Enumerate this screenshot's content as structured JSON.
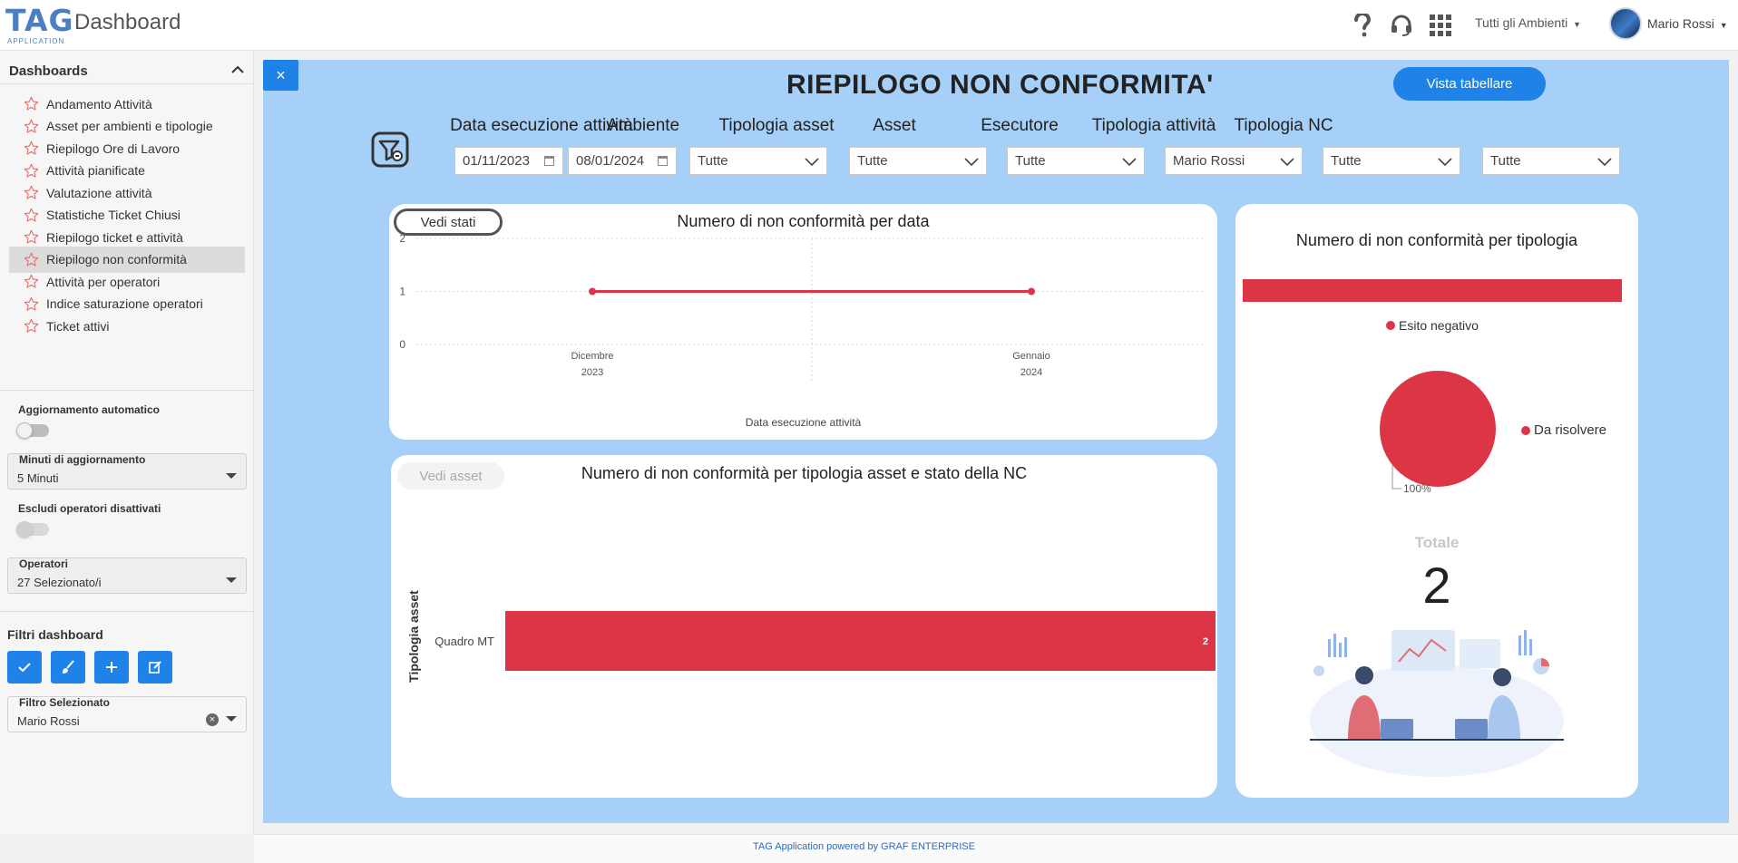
{
  "app": {
    "logo_text": "TAG",
    "logo_sub": "APPLICATION",
    "page_title": "Dashboard",
    "environment_selector": "Tutti gli Ambienti",
    "user_name": "Mario Rossi"
  },
  "sidebar": {
    "title": "Dashboards",
    "items": [
      {
        "label": "Andamento Attività"
      },
      {
        "label": "Asset per ambienti e tipologie"
      },
      {
        "label": "Riepilogo Ore di Lavoro"
      },
      {
        "label": "Attività pianificate"
      },
      {
        "label": "Valutazione attività"
      },
      {
        "label": "Statistiche Ticket Chiusi"
      },
      {
        "label": "Riepilogo ticket e attività"
      },
      {
        "label": "Riepilogo non conformità",
        "active": true
      },
      {
        "label": "Attività per operatori"
      },
      {
        "label": "Indice saturazione operatori"
      },
      {
        "label": "Ticket attivi"
      }
    ],
    "auto_update_label": "Aggiornamento automatico",
    "auto_update_on": false,
    "minutes_label": "Minuti di aggiornamento",
    "minutes_value": "5 Minuti",
    "exclude_label": "Escludi operatori disattivati",
    "exclude_on": false,
    "operators_label": "Operatori",
    "operators_value": "27 Selezionato/i",
    "filters_title": "Filtri dashboard",
    "filter_buttons": [
      "check-icon",
      "brush-icon",
      "plus-icon",
      "edit-icon"
    ],
    "selected_filter_label": "Filtro Selezionato",
    "selected_filter_value": "Mario Rossi"
  },
  "report": {
    "title": "RIEPILOGO NON CONFORMITA'",
    "table_view_button": "Vista tabellare",
    "close_label": "×",
    "filters": [
      {
        "label": "Data esecuzione attività",
        "from": "01/11/2023",
        "to": "08/01/2024"
      },
      {
        "label": "Ambiente",
        "value": "Tutte"
      },
      {
        "label": "Tipologia asset",
        "value": "Tutte"
      },
      {
        "label": "Asset",
        "value": "Tutte"
      },
      {
        "label": "Esecutore",
        "value": "Mario Rossi"
      },
      {
        "label": "Tipologia attività",
        "value": "Tutte"
      },
      {
        "label": "Tipologia NC",
        "value": "Tutte"
      }
    ],
    "accent_color": "#dc3545",
    "primary_color": "#1e82e8"
  },
  "line_card": {
    "button": "Vedi stati",
    "title": "Numero di non conformità per data"
  },
  "bar_card": {
    "button": "Vedi asset",
    "title": "Numero di non conformità per tipologia asset e stato della NC"
  },
  "pie_card": {
    "title": "Numero di non conformità per tipologia",
    "totale_label": "Totale",
    "totale_value": "2"
  },
  "chart_data": [
    {
      "type": "line",
      "title": "Numero di non conformità per data",
      "xlabel": "Data esecuzione attività",
      "ylabel": "",
      "x": [
        {
          "line1": "Dicembre",
          "line2": "2023"
        },
        {
          "line1": "Gennaio",
          "line2": "2024"
        }
      ],
      "series": [
        {
          "values": [
            1,
            1
          ]
        }
      ],
      "yticks": [
        "0",
        "1",
        "2"
      ],
      "ylim": [
        0,
        2
      ],
      "grid": true
    },
    {
      "type": "bar",
      "orientation": "horizontal",
      "title": "Numero di non conformità per tipologia asset e stato della NC",
      "ylabel": "Tipologia asset",
      "categories": [
        "Quadro MT"
      ],
      "values": [
        2
      ],
      "data_labels": [
        "2"
      ]
    },
    {
      "type": "pie",
      "title": "Numero di non conformità per tipologia",
      "legend_top": [
        "Esito negativo"
      ],
      "slices": [
        {
          "label": "Da risolvere",
          "value": 100,
          "data_label": "100%"
        }
      ]
    }
  ],
  "footer": "TAG Application powered by GRAF ENTERPRISE"
}
